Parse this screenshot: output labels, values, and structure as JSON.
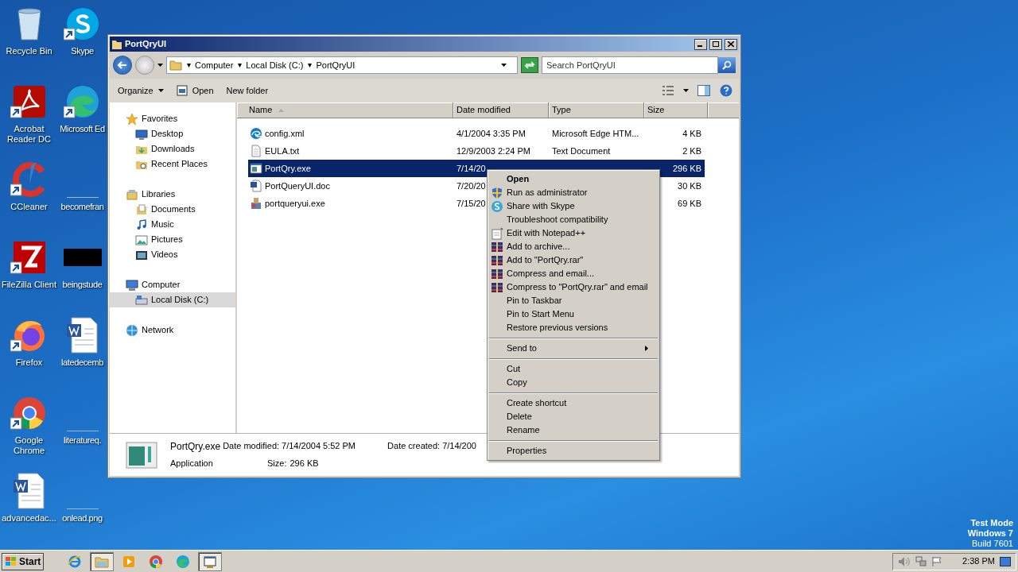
{
  "desktop": {
    "columns": [
      [
        {
          "label": "Recycle Bin",
          "kind": "recycle-bin",
          "shortcut": false
        },
        {
          "label": "Acrobat Reader DC",
          "kind": "acrobat",
          "shortcut": true
        },
        {
          "label": "CCleaner",
          "kind": "ccleaner",
          "shortcut": true
        },
        {
          "label": "FileZilla Client",
          "kind": "filezilla",
          "shortcut": true
        },
        {
          "label": "Firefox",
          "kind": "firefox",
          "shortcut": true
        },
        {
          "label": "Google Chrome",
          "kind": "chrome",
          "shortcut": true
        },
        {
          "label": "advancedac...",
          "kind": "word",
          "shortcut": false
        }
      ],
      [
        {
          "label": "Skype",
          "kind": "skype",
          "shortcut": true
        },
        {
          "label": "Microsoft Ed",
          "kind": "edge",
          "shortcut": true
        },
        {
          "label": "becomefran",
          "kind": "blank",
          "shortcut": false
        },
        {
          "label": "beingstude",
          "kind": "dark-image",
          "shortcut": false
        },
        {
          "label": "latedecemb",
          "kind": "word",
          "shortcut": false
        },
        {
          "label": "literatureq.",
          "kind": "blank",
          "shortcut": false
        },
        {
          "label": "onlead.png",
          "kind": "blank",
          "shortcut": false
        }
      ]
    ],
    "system_text": [
      "Test Mode",
      "Windows 7",
      "Build 7601"
    ]
  },
  "window": {
    "title": "PortQryUI",
    "breadcrumb": [
      "Computer",
      "Local Disk (C:)",
      "PortQryUI"
    ],
    "search": {
      "placeholder": "Search PortQryUI"
    },
    "toolbar": [
      {
        "label": "Organize",
        "kind": "menu"
      },
      {
        "label": "Open",
        "kind": "open"
      },
      {
        "label": "New folder",
        "kind": "plain"
      }
    ],
    "nav": [
      {
        "label": "Favorites",
        "kind": "star",
        "children": [
          {
            "label": "Desktop",
            "kind": "desktop",
            "selected": false
          },
          {
            "label": "Downloads",
            "kind": "downloads",
            "selected": false
          },
          {
            "label": "Recent Places",
            "kind": "recent",
            "selected": false
          }
        ]
      },
      {
        "label": "Libraries",
        "kind": "library",
        "children": [
          {
            "label": "Documents",
            "kind": "documents",
            "selected": false
          },
          {
            "label": "Music",
            "kind": "music",
            "selected": false
          },
          {
            "label": "Pictures",
            "kind": "pictures",
            "selected": false
          },
          {
            "label": "Videos",
            "kind": "videos",
            "selected": false
          }
        ]
      },
      {
        "label": "Computer",
        "kind": "computer",
        "children": [
          {
            "label": "Local Disk (C:)",
            "kind": "disk",
            "selected": true
          }
        ]
      },
      {
        "label": "Network",
        "kind": "network"
      }
    ],
    "columns": [
      "Name",
      "Date modified",
      "Type",
      "Size"
    ],
    "rows": [
      {
        "name": "config.xml",
        "date": "4/1/2004 3:35 PM",
        "type": "Microsoft Edge HTM...",
        "size": "4 KB",
        "kind": "html",
        "selected": false
      },
      {
        "name": "EULA.txt",
        "date": "12/9/2003 2:24 PM",
        "type": "Text Document",
        "size": "2 KB",
        "kind": "text",
        "selected": false
      },
      {
        "name": "PortQry.exe",
        "date": "7/14/20",
        "size": "296 KB",
        "kind": "app",
        "selected": true
      },
      {
        "name": "PortQueryUI.doc",
        "date": "7/20/20",
        "size": "30 KB",
        "kind": "doc",
        "selected": false
      },
      {
        "name": "portqueryui.exe",
        "date": "7/15/20",
        "size": "69 KB",
        "kind": "setup",
        "selected": false
      }
    ],
    "details": {
      "name": "PortQry.exe",
      "type": "Application",
      "modified_label": "Date modified:",
      "modified": "7/14/2004 5:52 PM",
      "size_label": "Size:",
      "size": "296 KB",
      "created_label": "Date created:",
      "created": "7/14/200"
    }
  },
  "context_menu": [
    {
      "label": "Open",
      "kind": "default"
    },
    {
      "label": "Run as administrator",
      "kind": "shield"
    },
    {
      "label": "Share with Skype",
      "kind": "skype"
    },
    {
      "label": "Troubleshoot compatibility",
      "kind": "plain"
    },
    {
      "label": "Edit with Notepad++",
      "kind": "notepad"
    },
    {
      "label": "Add to archive...",
      "kind": "archive"
    },
    {
      "label": "Add to \"PortQry.rar\"",
      "kind": "archive"
    },
    {
      "label": "Compress and email...",
      "kind": "archive"
    },
    {
      "label": "Compress to \"PortQry.rar\" and email",
      "kind": "archive"
    },
    {
      "label": "Pin to Taskbar",
      "kind": "plain"
    },
    {
      "label": "Pin to Start Menu",
      "kind": "plain"
    },
    {
      "label": "Restore previous versions",
      "kind": "plain"
    },
    {
      "kind": "separator"
    },
    {
      "label": "Send to",
      "kind": "submenu"
    },
    {
      "kind": "separator"
    },
    {
      "label": "Cut",
      "kind": "plain"
    },
    {
      "label": "Copy",
      "kind": "plain"
    },
    {
      "kind": "separator"
    },
    {
      "label": "Create shortcut",
      "kind": "plain"
    },
    {
      "label": "Delete",
      "kind": "plain"
    },
    {
      "label": "Rename",
      "kind": "plain"
    },
    {
      "kind": "separator"
    },
    {
      "label": "Properties",
      "kind": "plain"
    }
  ],
  "taskbar": {
    "start": "Start",
    "apps": [
      {
        "kind": "ie",
        "selected": false
      },
      {
        "kind": "explorer",
        "selected": true
      },
      {
        "kind": "media",
        "selected": false
      },
      {
        "kind": "chrome",
        "selected": false
      },
      {
        "kind": "edge",
        "selected": false
      },
      {
        "kind": "app",
        "selected": true
      }
    ],
    "time": "2:38 PM"
  }
}
